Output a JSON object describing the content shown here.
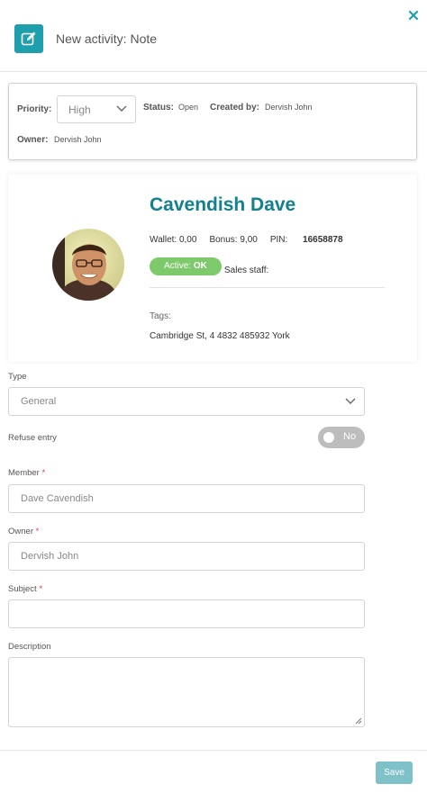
{
  "header": {
    "title": "New activity: Note",
    "icon": "edit-note-icon",
    "accent": "#1e9fae"
  },
  "meta": {
    "priority_label": "Priority:",
    "priority_value": "High",
    "status_label": "Status:",
    "status_value": "Open",
    "created_by_label": "Created by:",
    "created_by_value": "Dervish John",
    "owner_label": "Owner:",
    "owner_value": "Dervish John"
  },
  "member_card": {
    "name": "Cavendish Dave",
    "wallet": "Wallet: 0,00",
    "bonus": "Bonus: 9,00",
    "pin_label": "PIN:",
    "pin_value": "16658878",
    "status_prefix": "Active:",
    "status_value": "OK",
    "sales_staff": "Sales staff:",
    "tags": "Tags:",
    "address": "Cambridge St, 4 4832 485932 York",
    "name_color": "#11808f",
    "status_color": "#7dc96b"
  },
  "form": {
    "type_label": "Type",
    "type_value": "General",
    "refuse_label": "Refuse entry",
    "refuse_toggle": "No",
    "member_label": "Member",
    "member_value": "Dave Cavendish",
    "owner_label": "Owner",
    "owner_value": "Dervish John",
    "subject_label": "Subject",
    "subject_value": "",
    "description_label": "Description",
    "required_mark": "*"
  },
  "footer": {
    "save_label": "Save",
    "save_color": "#7fc1c9"
  }
}
